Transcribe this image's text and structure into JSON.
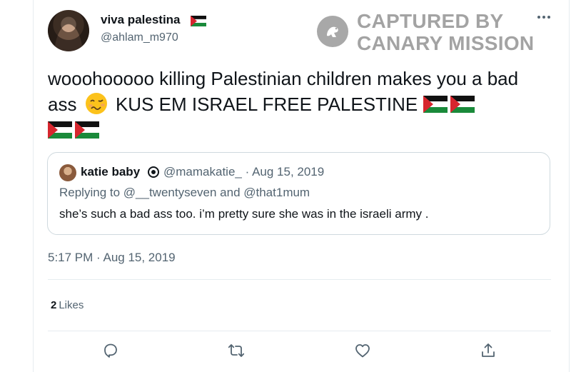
{
  "author": {
    "display_name": "viva palestina",
    "handle": "@ahlam_m970"
  },
  "watermark": {
    "line1": "CAPTURED BY",
    "line2": "CANARY MISSION"
  },
  "tweet": {
    "text_part1": "wooohooooo killing Palestinian children makes you a bad ass",
    "text_part2": "KUS EM ISRAEL FREE PALESTINE",
    "timestamp": "5:17 PM · Aug 15, 2019",
    "likes_count": "2",
    "likes_label": "Likes"
  },
  "quoted_tweet": {
    "display_name": "katie baby",
    "handle": "@mamakatie_",
    "separator": "·",
    "date": "Aug 15, 2019",
    "replying_to": "Replying to @__twentyseven and @that1mum",
    "body": "she’s such a bad ass too. i’m pretty sure she was in the israeli army ."
  },
  "icons": {
    "more": "more-horizontal-icon",
    "reply": "reply-icon",
    "retweet": "retweet-icon",
    "like": "heart-icon",
    "share": "share-icon",
    "flag": "palestine-flag-icon",
    "woozy": "woozy-face-icon"
  },
  "colors": {
    "text_primary": "#0f1419",
    "text_secondary": "#536471",
    "border": "#cfd9de",
    "watermark": "#a3a3a3"
  }
}
